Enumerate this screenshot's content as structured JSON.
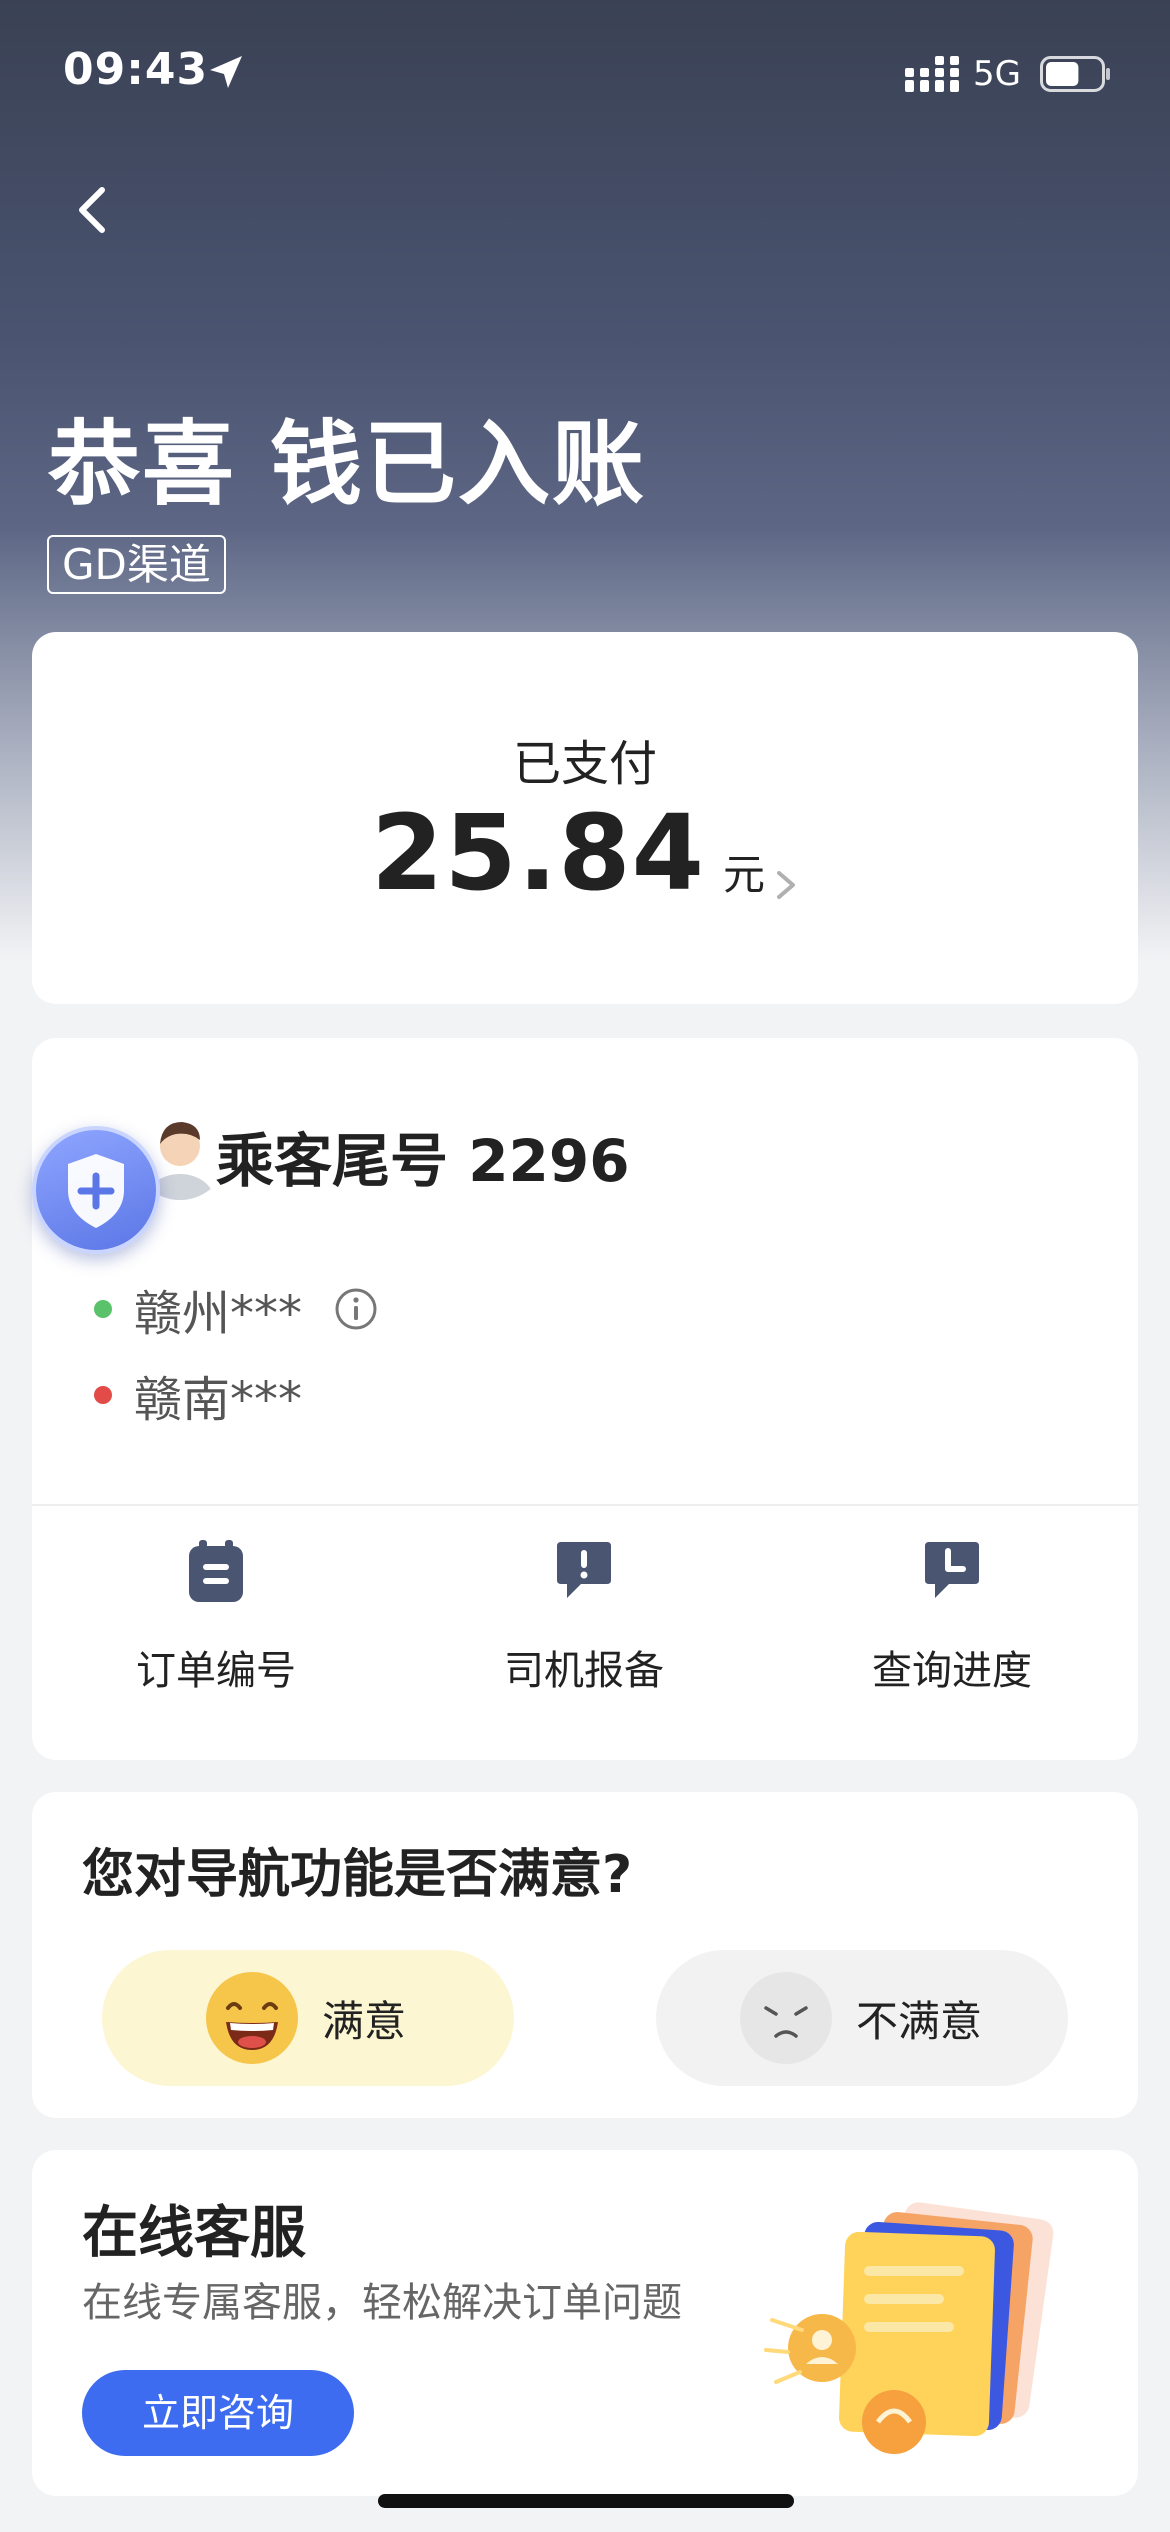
{
  "status_bar": {
    "time": "09:43",
    "network": "5G",
    "battery_percent": 60
  },
  "header": {
    "title": "恭喜 钱已入账",
    "channel_tag": "GD渠道"
  },
  "payment": {
    "label": "已支付",
    "amount": "25.84",
    "unit": "元"
  },
  "trip": {
    "passenger": "乘客尾号 2296",
    "origin": "赣州***",
    "destination": "赣南***",
    "actions": [
      {
        "label": "订单编号",
        "icon": "order-icon"
      },
      {
        "label": "司机报备",
        "icon": "report-icon"
      },
      {
        "label": "查询进度",
        "icon": "progress-icon"
      }
    ]
  },
  "survey": {
    "question": "您对导航功能是否满意?",
    "yes_label": "满意",
    "no_label": "不满意"
  },
  "service": {
    "title": "在线客服",
    "subtitle": "在线专属客服，轻松解决订单问题",
    "button": "立即咨询"
  },
  "colors": {
    "accent": "#3d6cf0",
    "origin_dot": "#5ac26a",
    "destination_dot": "#e24b47",
    "icon": "#4a5572"
  }
}
